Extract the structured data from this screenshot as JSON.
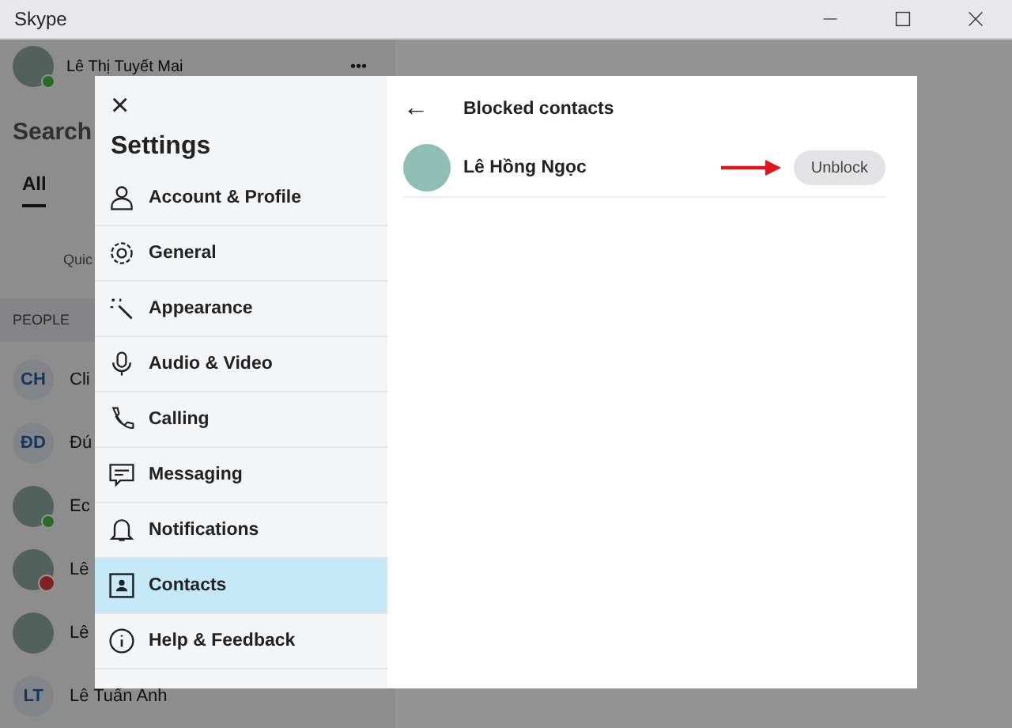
{
  "window": {
    "title": "Skype"
  },
  "background": {
    "profile": {
      "name": "Lê Thị Tuyết Mai",
      "online": true,
      "more": "•••"
    },
    "search": {
      "placeholder": "Search"
    },
    "tabs": [
      {
        "label": "All",
        "selected": true
      }
    ],
    "hint": "Quic",
    "section": "PEOPLE",
    "contacts": [
      {
        "kind": "initials",
        "initials": "CH",
        "name": "Cli",
        "online": false,
        "blocked": false
      },
      {
        "kind": "initials",
        "initials": "ĐD",
        "name": "Đú",
        "online": false,
        "blocked": false
      },
      {
        "kind": "photo",
        "name": "Ec",
        "online": true,
        "blocked": false
      },
      {
        "kind": "photo",
        "name": "Lê",
        "online": false,
        "blocked": true
      },
      {
        "kind": "photo",
        "name": "Lê",
        "online": false,
        "blocked": false
      },
      {
        "kind": "initials",
        "initials": "LT",
        "name": "Lê Tuấn Anh",
        "online": false,
        "blocked": false
      }
    ]
  },
  "settings": {
    "close": "×",
    "title": "Settings",
    "nav": [
      {
        "label": "Account & Profile",
        "selected": false
      },
      {
        "label": "General",
        "selected": false
      },
      {
        "label": "Appearance",
        "selected": false
      },
      {
        "label": "Audio & Video",
        "selected": false
      },
      {
        "label": "Calling",
        "selected": false
      },
      {
        "label": "Messaging",
        "selected": false
      },
      {
        "label": "Notifications",
        "selected": false
      },
      {
        "label": "Contacts",
        "selected": true
      },
      {
        "label": "Help & Feedback",
        "selected": false
      }
    ],
    "pane": {
      "back": "←",
      "title": "Blocked contacts",
      "blocked": [
        {
          "name": "Lê Hồng Ngọc",
          "button": "Unblock",
          "highlighted": true
        }
      ]
    }
  }
}
